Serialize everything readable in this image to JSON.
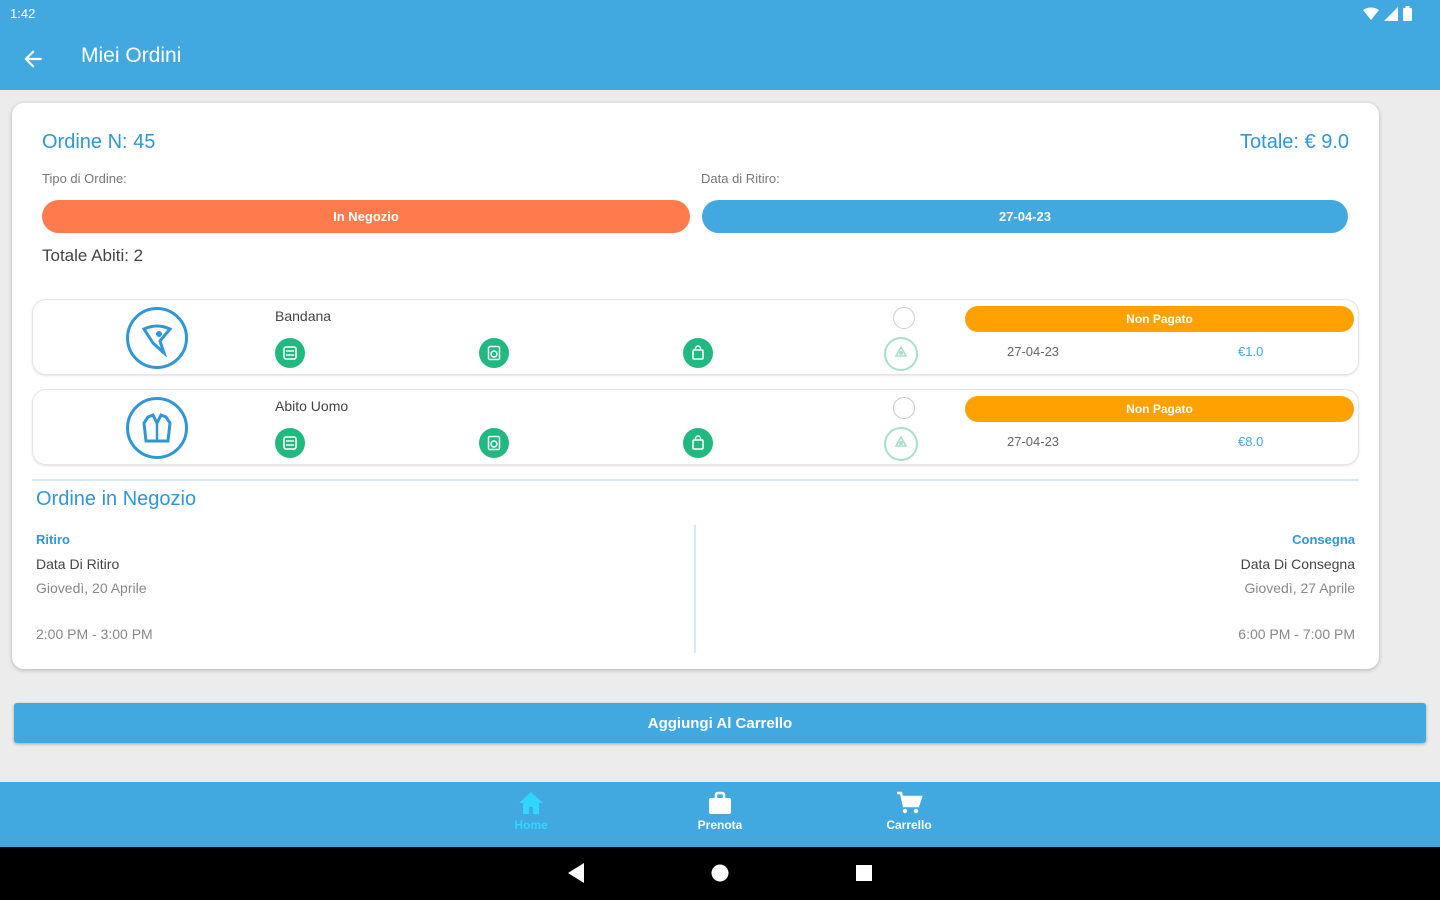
{
  "status_bar": {
    "time": "1:42"
  },
  "app_bar": {
    "title": "Miei Ordini"
  },
  "order": {
    "number_label": "Ordine N: 45",
    "total_label": "Totale: € 9.0",
    "tipo_label": "Tipo di Ordine:",
    "data_ritiro_label": "Data di Ritiro:",
    "tipo_value": "In Negozio",
    "data_ritiro_value": "27-04-23",
    "totale_abiti": "Totale Abiti: 2"
  },
  "items": [
    {
      "name": "Bandana",
      "status": "Non Pagato",
      "date": "27-04-23",
      "price": "€1.0"
    },
    {
      "name": "Abito Uomo",
      "status": "Non Pagato",
      "date": "27-04-23",
      "price": "€8.0"
    }
  ],
  "section": {
    "title": "Ordine in Negozio",
    "pickup": {
      "heading": "Ritiro",
      "label": "Data Di Ritiro",
      "date": "Giovedì, 20 Aprile",
      "time": "2:00 PM - 3:00 PM"
    },
    "delivery": {
      "heading": "Consegna",
      "label": "Data Di Consegna",
      "date": "Giovedì, 27 Aprile",
      "time": "6:00 PM - 7:00 PM"
    }
  },
  "add_to_cart": "Aggiungi Al Carrello",
  "bottom_nav": [
    {
      "label": "Home",
      "icon": "home-icon",
      "active": true
    },
    {
      "label": "Prenota",
      "icon": "briefcase-icon",
      "active": false
    },
    {
      "label": "Carrello",
      "icon": "cart-icon",
      "active": false
    }
  ],
  "colors": {
    "primary": "#42a8e0",
    "accent_text": "#2f97d8",
    "order_type": "#ff7a4d",
    "unpaid": "#ffa100",
    "status_icon": "#21b97f",
    "active_nav": "#2fd7ff"
  }
}
